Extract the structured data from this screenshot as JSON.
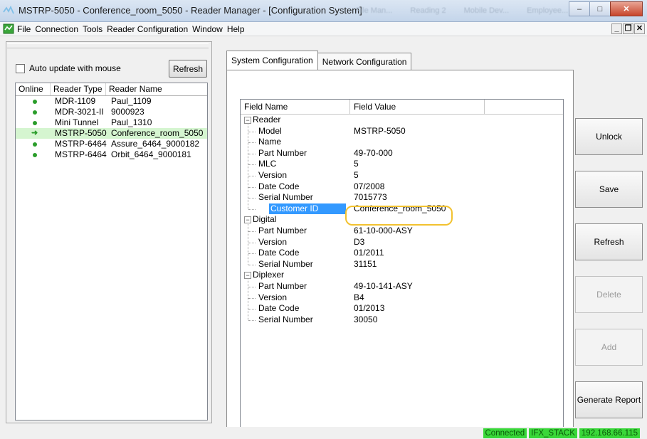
{
  "window": {
    "title": "MSTRP-5050 - Conference_room_5050 - Reader Manager - [Configuration System]",
    "background_tabs": [
      "File Man...",
      "Reading 2",
      "Mobile Dev...",
      "Employee..."
    ],
    "minimize": "–",
    "maximize": "□",
    "close": "✕"
  },
  "menu": {
    "items": [
      "File",
      "Connection",
      "Tools",
      "Reader Configuration",
      "Window",
      "Help"
    ],
    "mdi_min": "_",
    "mdi_restore": "❐",
    "mdi_close": "✕"
  },
  "left_panel": {
    "auto_update_label": "Auto update with mouse",
    "auto_update_checked": false,
    "refresh_label": "Refresh",
    "columns": [
      "Online",
      "Reader Type",
      "Reader Name"
    ],
    "readers": [
      {
        "status": "online",
        "type": "MDR-1109",
        "name": "Paul_1109"
      },
      {
        "status": "online",
        "type": "MDR-3021-II",
        "name": "9000923"
      },
      {
        "status": "online",
        "type": "Mini Tunnel",
        "name": "Paul_1310"
      },
      {
        "status": "current",
        "type": "MSTRP-5050",
        "name": "Conference_room_5050"
      },
      {
        "status": "online",
        "type": "MSTRP-6464",
        "name": "Assure_6464_9000182"
      },
      {
        "status": "online",
        "type": "MSTRP-6464",
        "name": "Orbit_6464_9000181"
      }
    ]
  },
  "tabs": [
    "System Configuration",
    "Network Configuration"
  ],
  "active_tab": 0,
  "config_grid": {
    "columns": [
      "Field Name",
      "Field Value"
    ],
    "groups": [
      {
        "name": "Reader",
        "fields": [
          {
            "name": "Model",
            "value": "MSTRP-5050"
          },
          {
            "name": "Name",
            "value": ""
          },
          {
            "name": "Part Number",
            "value": "49-70-000"
          },
          {
            "name": "MLC",
            "value": "5"
          },
          {
            "name": "Version",
            "value": "5"
          },
          {
            "name": "Date Code",
            "value": "07/2008"
          },
          {
            "name": "Serial Number",
            "value": "7015773"
          },
          {
            "name": "Customer ID",
            "value": "Conference_room_5050",
            "selected": true
          }
        ]
      },
      {
        "name": "Digital",
        "fields": [
          {
            "name": "Part Number",
            "value": "61-10-000-ASY"
          },
          {
            "name": "Version",
            "value": "D3"
          },
          {
            "name": "Date Code",
            "value": "01/2011"
          },
          {
            "name": "Serial Number",
            "value": "31151"
          }
        ]
      },
      {
        "name": "Diplexer",
        "fields": [
          {
            "name": "Part Number",
            "value": "49-10-141-ASY"
          },
          {
            "name": "Version",
            "value": "B4"
          },
          {
            "name": "Date Code",
            "value": "01/2013"
          },
          {
            "name": "Serial Number",
            "value": "30050"
          }
        ]
      }
    ]
  },
  "side_buttons": [
    {
      "label": "Unlock",
      "enabled": true
    },
    {
      "label": "Save",
      "enabled": true
    },
    {
      "label": "Refresh",
      "enabled": true
    },
    {
      "label": "Delete",
      "enabled": false
    },
    {
      "label": "Add",
      "enabled": false
    },
    {
      "label": "Generate Report",
      "enabled": true
    }
  ],
  "status_bar": {
    "connection": "Connected",
    "stack": "IFX_STACK",
    "ip": "192.168.66.115"
  },
  "colors": {
    "online_indicator": "#2a9d2a",
    "selected_reader_row": "#d5f5d0",
    "selected_field": "#3399ff",
    "highlight_oval": "#f2c230",
    "status_green": "#39d739"
  }
}
